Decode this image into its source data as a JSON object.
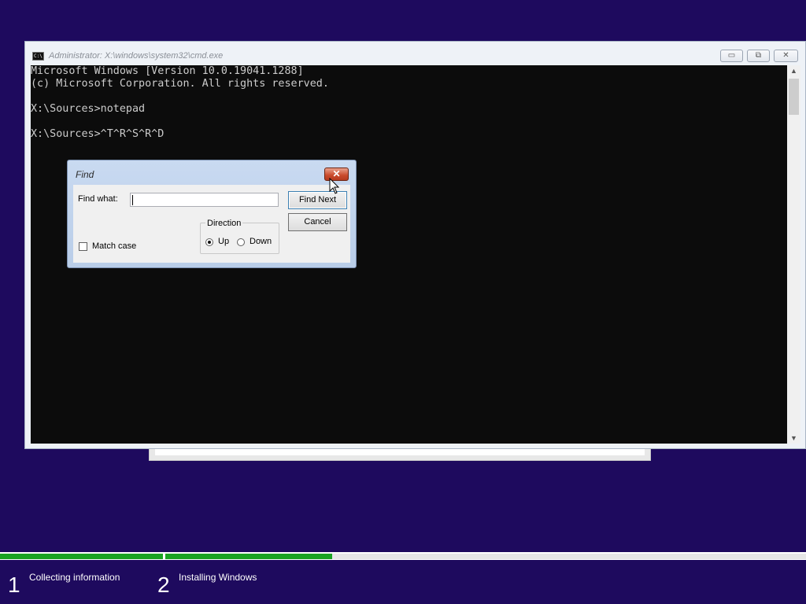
{
  "cmd_window": {
    "title": "Administrator: X:\\windows\\system32\\cmd.exe",
    "icon": "cmd-icon",
    "icon_text": "C:\\",
    "minimize_symbol": "▭",
    "maximize_symbol": "⧉",
    "close_symbol": "✕",
    "console_lines": [
      "Microsoft Windows [Version 10.0.19041.1288]",
      "(c) Microsoft Corporation. All rights reserved.",
      "",
      "X:\\Sources>notepad",
      "",
      "X:\\Sources>^T^R^S^R^D"
    ]
  },
  "find_dialog": {
    "title": "Find",
    "find_what_label": "Find what:",
    "find_what_value": "",
    "find_next_label": "Find Next",
    "cancel_label": "Cancel",
    "direction_label": "Direction",
    "up_label": "Up",
    "down_label": "Down",
    "direction_selected": "Up",
    "match_case_label": "Match case",
    "match_case_checked": false
  },
  "setup_progress": {
    "steps": [
      {
        "number": "1",
        "label": "Collecting information",
        "progress": 1.0
      },
      {
        "number": "2",
        "label": "Installing Windows",
        "progress": 0.26
      }
    ],
    "accent_color": "#1ba323"
  },
  "colors": {
    "background": "#1e0a5e",
    "console_bg": "#0c0c0c",
    "console_text": "#cccccc"
  }
}
